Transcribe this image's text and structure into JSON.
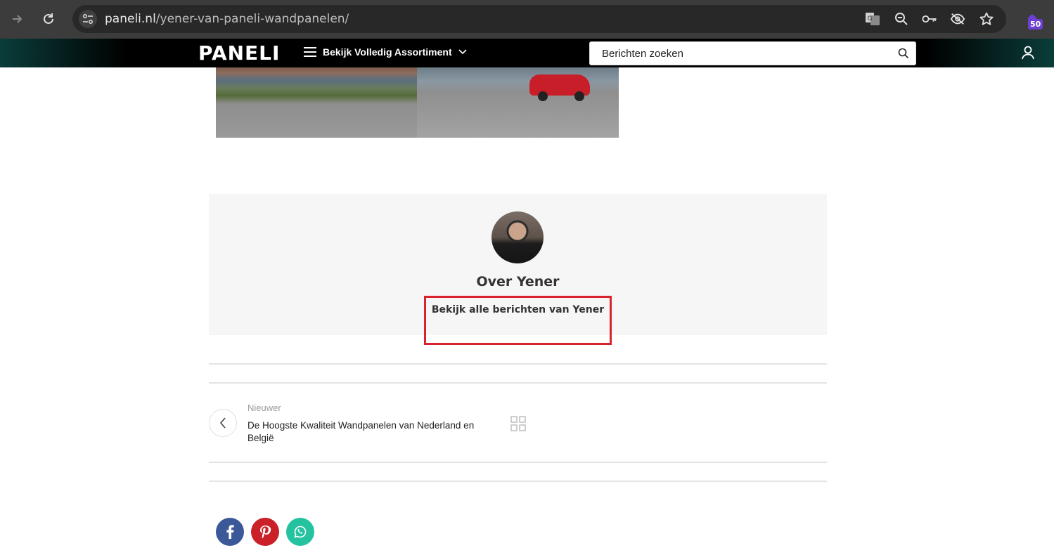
{
  "browser": {
    "url_host": "paneli.nl",
    "url_path": "/yener-van-paneli-wandpanelen/",
    "extension_badge": "50",
    "icons": [
      "forward-icon",
      "reload-icon",
      "site-info-icon",
      "translate-icon",
      "zoom-out-icon",
      "key-icon",
      "eye-off-icon",
      "star-icon",
      "extension-icon"
    ]
  },
  "header": {
    "logo": "PANELI",
    "menu_label": "Bekijk Volledig Assortiment",
    "search_placeholder": "Berichten zoeken"
  },
  "author": {
    "heading": "Over Yener",
    "all_posts_link": "Bekijk alle berichten van Yener"
  },
  "post_nav": {
    "kicker": "Nieuwer",
    "title": "De Hoogste Kwaliteit Wandpanelen van Nederland en België"
  },
  "share": {
    "networks": [
      "facebook",
      "pinterest",
      "whatsapp"
    ],
    "colors": {
      "facebook": "#3b5998",
      "pinterest": "#cb2027",
      "whatsapp": "#25c2a0"
    }
  },
  "colors": {
    "accent_highlight": "#d9232d",
    "header_bg": "#000000"
  }
}
